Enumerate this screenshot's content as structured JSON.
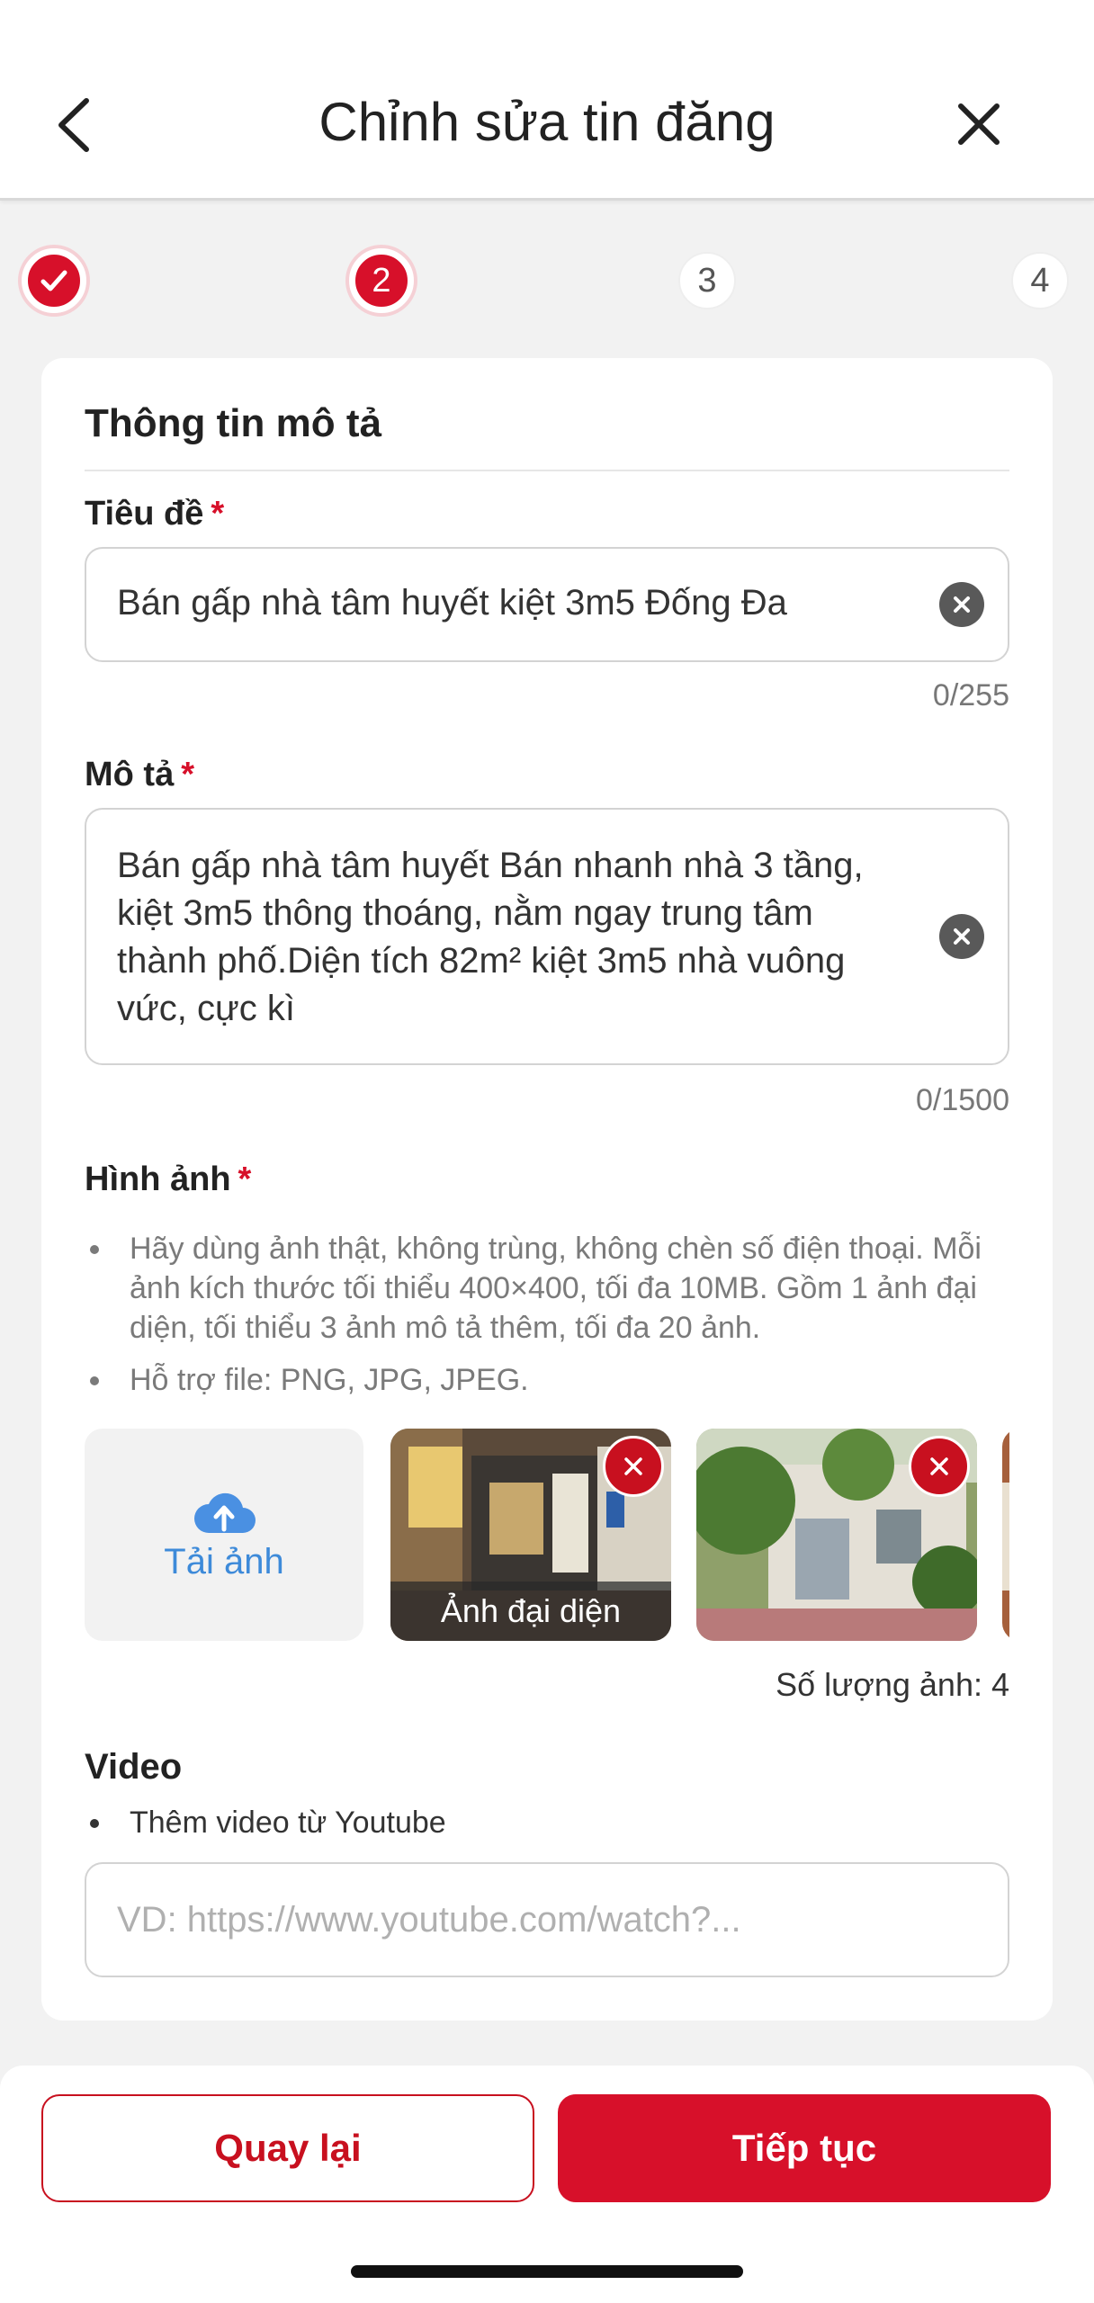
{
  "header": {
    "title": "Chỉnh sửa tin đăng",
    "back_icon": "chevron-left-icon",
    "close_icon": "close-icon"
  },
  "stepper": {
    "current_step": 2,
    "steps": [
      {
        "label": "",
        "state": "done"
      },
      {
        "label": "2",
        "state": "active"
      },
      {
        "label": "3",
        "state": "todo"
      },
      {
        "label": "4",
        "state": "todo"
      }
    ],
    "accent_color": "#d7102a"
  },
  "card": {
    "section_title": "Thông tin mô tả",
    "title_field": {
      "label": "Tiêu đề",
      "required_mark": "*",
      "value": "Bán gấp nhà tâm huyết kiệt 3m5 Đống Đa",
      "counter": "0/255"
    },
    "description_field": {
      "label": "Mô tả",
      "required_mark": "*",
      "value": "Bán gấp nhà tâm huyết Bán nhanh nhà 3 tầng, kiệt 3m5 thông thoáng, nằm ngay trung tâm thành phố.Diện tích 82m² kiệt 3m5 nhà vuông vức, cực kì",
      "counter": "0/1500"
    },
    "images": {
      "label": "Hình ảnh",
      "required_mark": "*",
      "bullets": [
        "Hãy dùng ảnh thật, không trùng, không chèn số điện thoại. Mỗi ảnh kích thước tối thiểu 400×400, tối đa 10MB. Gồm 1 ảnh đại diện, tối thiểu 3 ảnh mô tả thêm, tối đa 20 ảnh.",
        "Hỗ trợ file: PNG, JPG, JPEG."
      ],
      "upload_label": "Tải ảnh",
      "cover_caption": "Ảnh đại diện",
      "count_text": "Số lượng ảnh: 4"
    },
    "video": {
      "label": "Video",
      "bullet": "Thêm video từ Youtube",
      "placeholder": "VD: https://www.youtube.com/watch?..."
    }
  },
  "footer": {
    "back_label": "Quay lại",
    "next_label": "Tiếp tục"
  }
}
